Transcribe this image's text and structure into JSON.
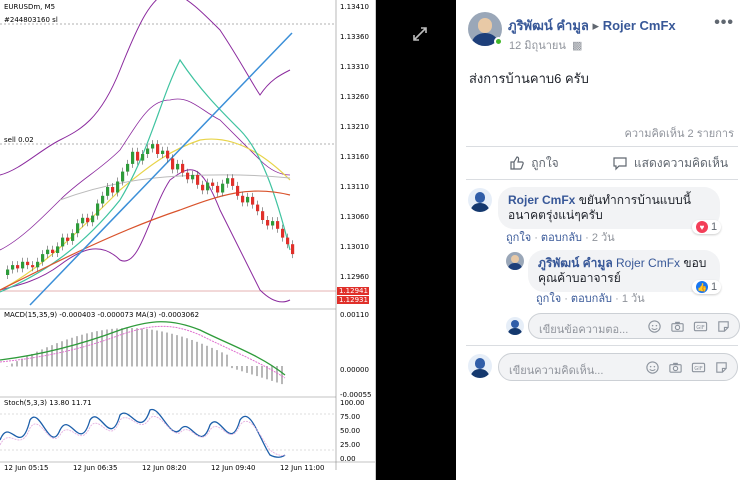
{
  "chart": {
    "symbol": "EURUSDm, M5",
    "order_label": "#244803160 sl",
    "sell_label": "sell 0.02",
    "price_axis": [
      "1.13410",
      "1.13360",
      "1.13310",
      "1.13260",
      "1.13210",
      "1.13160",
      "1.13110",
      "1.13060",
      "1.13010",
      "1.12960"
    ],
    "price_tag_1": "1.12941",
    "price_tag_2": "1.12931",
    "macd_label": "MACD(15,35,9) -0.000403 -0.000073 MA(3) -0.0003062",
    "macd_axis": [
      "0.00110",
      "0.00000",
      "-0.00055"
    ],
    "stoch_label": "Stoch(5,3,3) 13.80 11.71",
    "stoch_axis": [
      "100.00",
      "75.00",
      "50.00",
      "25.00",
      "0.00"
    ],
    "time_axis": [
      "12 Jun 05:15",
      "12 Jun 06:35",
      "12 Jun 08:20",
      "12 Jun 09:40",
      "12 Jun 11:00"
    ],
    "colors": {
      "bull": "#2e9b3a",
      "bear": "#e0302a",
      "bb": "#8b2a9e",
      "trend": "#3b8fd8",
      "ma_yellow": "#e8d44a",
      "ma_green": "#3fc3a0",
      "ma_red": "#d9532c",
      "ma_gray": "#bbbbbb"
    }
  },
  "post": {
    "author": "ภูริพัฒน์ คำมูล",
    "arrow": "▸",
    "page": "Rojer CmFx",
    "date": "12 มิถุนายน",
    "privacy_icon": "group-icon",
    "text": "ส่งการบ้านคาบ6 ครับ",
    "comment_count": "ความคิดเห็น 2 รายการ",
    "like_label": "ถูกใจ",
    "comment_label": "แสดงความคิดเห็น"
  },
  "comments": [
    {
      "author": "Rojer CmFx",
      "text_line1": "ขยันทำการบ้านแบบนี้",
      "text_line2": "อนาคตรุ่งแน่ๆครับ",
      "like": "ถูกใจ",
      "reply": "ตอบกลับ",
      "time": "2 วัน",
      "reaction_count": "1",
      "reaction": "heart"
    },
    {
      "author": "ภูริพัฒน์ คำมูล",
      "mention": "Rojer CmFx",
      "text_line1": "ขอบ",
      "text_line2": "คุณค้าบอาจารย์",
      "like": "ถูกใจ",
      "reply": "ตอบกลับ",
      "time": "1 วัน",
      "reaction_count": "1",
      "reaction": "like"
    }
  ],
  "reply_input": {
    "placeholder": "เขียนข้อความตอ..."
  },
  "comment_input": {
    "placeholder": "เขียนความคิดเห็น..."
  }
}
